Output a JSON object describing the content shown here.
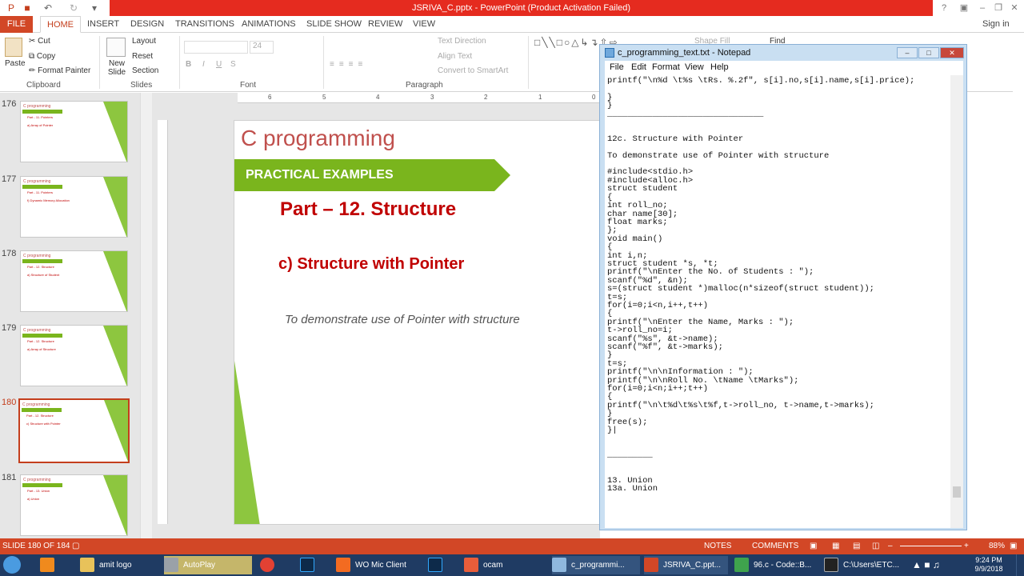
{
  "window": {
    "title": "JSRIVA_C.pptx - PowerPoint (Product Activation Failed)",
    "signin": "Sign in"
  },
  "tabs": [
    "FILE",
    "HOME",
    "INSERT",
    "DESIGN",
    "TRANSITIONS",
    "ANIMATIONS",
    "SLIDE SHOW",
    "REVIEW",
    "VIEW"
  ],
  "ribbon": {
    "paste": "Paste",
    "cut": "Cut",
    "copy": "Copy",
    "format_painter": "Format Painter",
    "clipboard": "Clipboard",
    "new_slide": "New Slide",
    "layout": "Layout",
    "reset": "Reset",
    "section": "Section",
    "slides": "Slides",
    "font_size": "24",
    "font": "Font",
    "text_direction": "Text Direction",
    "align_text": "Align Text",
    "convert_smartart": "Convert to SmartArt",
    "paragraph": "Paragraph",
    "shape_fill": "Shape Fill",
    "find": "Find"
  },
  "thumbnails": [
    {
      "num": "176",
      "line1": "Part - 11. Pointers",
      "line2": "a) Array of Pointer"
    },
    {
      "num": "177",
      "line1": "Part - 11. Pointers",
      "line2": "f) Dynamic Memory Allocation"
    },
    {
      "num": "178",
      "line1": "Part - 12. Structure",
      "line2": "a) Structure of Student"
    },
    {
      "num": "179",
      "line1": "Part - 12. Structure",
      "line2": "a) Array of Structure"
    },
    {
      "num": "180",
      "line1": "Part - 12. Structure",
      "line2": "c) Structure with Pointer"
    },
    {
      "num": "181",
      "line1": "Part - 13. Union",
      "line2": "a) Union"
    }
  ],
  "ruler": [
    "6",
    "5",
    "4",
    "3",
    "2",
    "1",
    "0"
  ],
  "slide": {
    "title": "C programming",
    "band": "PRACTICAL EXAMPLES",
    "heading": "Part – 12. Structure",
    "subheading": "c) Structure with Pointer",
    "description": "To demonstrate use of Pointer with structure"
  },
  "notepad": {
    "title": "c_programming_text.txt - Notepad",
    "menu": [
      "File",
      "Edit",
      "Format",
      "View",
      "Help"
    ],
    "content": "printf(\"\\n%d \\t%s \\tRs. %.2f\", s[i].no,s[i].name,s[i].price);\n\n}\n}\n_______________________________\n\n\n12c. Structure with Pointer\n\nTo demonstrate use of Pointer with structure\n\n#include<stdio.h>\n#include<alloc.h>\nstruct student\n{\nint roll_no;\nchar name[30];\nfloat marks;\n};\nvoid main()\n{\nint i,n;\nstruct student *s, *t;\nprintf(\"\\nEnter the No. of Students : \");\nscanf(\"%d\", &n);\ns=(struct student *)malloc(n*sizeof(struct student));\nt=s;\nfor(i=0;i<n,i++,t++)\n{\nprintf(\"\\nEnter the Name, Marks : \");\nt->roll_no=i;\nscanf(\"%s\", &t->name);\nscanf(\"%f\", &t->marks);\n}\nt=s;\nprintf(\"\\n\\nInformation : \");\nprintf(\"\\n\\nRoll No. \\tName \\tMarks\");\nfor(i=0;i<n;i++;t++)\n{\nprintf(\"\\n\\t%d\\t%s\\t%f,t->roll_no, t->name,t->marks);\n}\nfree(s);\n}|\n\n\n_________\n\n\n13. Union\n13a. Union"
  },
  "status": {
    "slide": "SLIDE 180 OF 184",
    "notes": "NOTES",
    "comments": "COMMENTS",
    "zoom": "88%"
  },
  "taskbar": {
    "items": [
      "amit logo",
      "AutoPlay",
      "",
      "",
      "WO Mic Client",
      "",
      "ocam",
      "c_programmi...",
      "JSRIVA_C.ppt...",
      "96.c - Code::B...",
      "C:\\Users\\ETC..."
    ],
    "time": "9:24 PM",
    "date": "9/9/2018"
  },
  "colors": {
    "accent": "#d24726",
    "slide_red": "#c00000",
    "slide_green": "#7ab51d",
    "taskbar": "#1f3b63"
  }
}
